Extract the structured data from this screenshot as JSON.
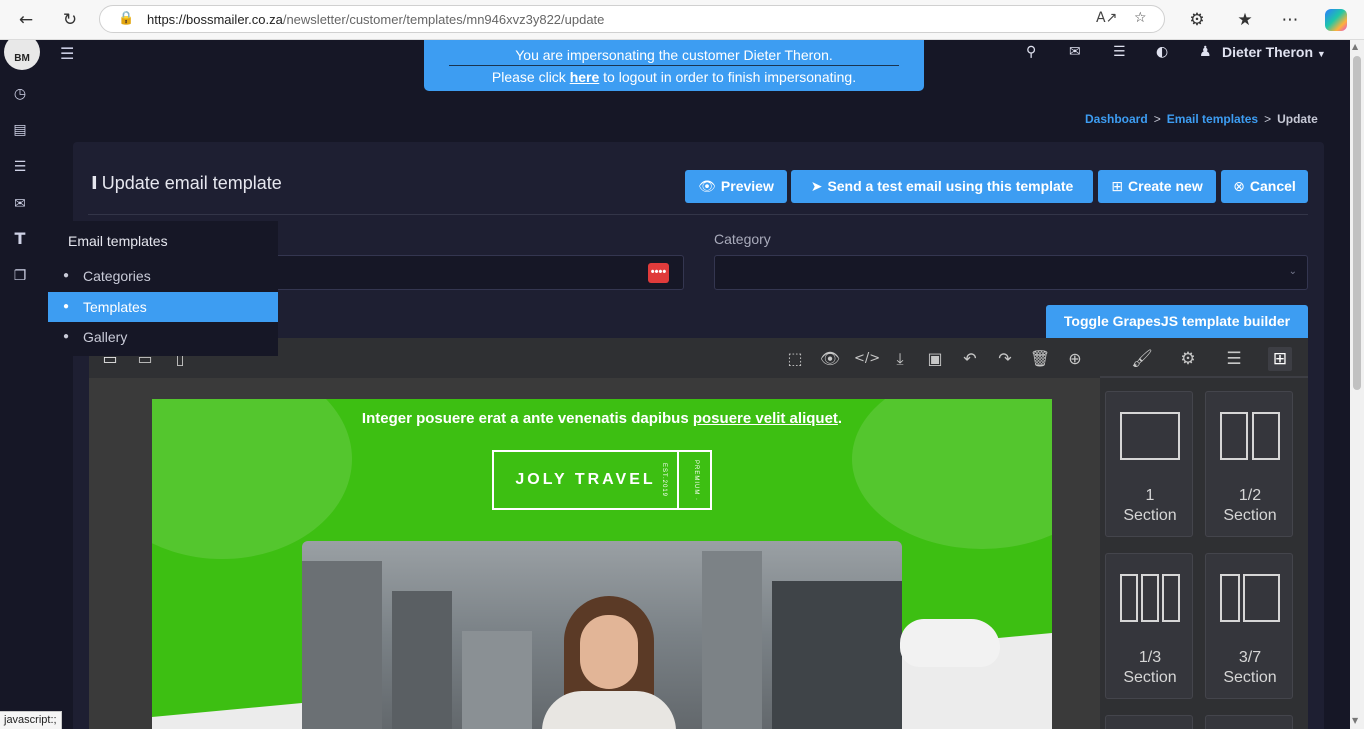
{
  "browser": {
    "url_host": "https://bossmailer.co.za",
    "url_path": "/newsletter/customer/templates/mn946xvz3y822/update",
    "status_text": "javascript:;"
  },
  "topbar": {
    "username": "Dieter Theron",
    "icons": [
      "search-icon",
      "envelope-icon",
      "list-icon",
      "contrast-icon",
      "user-icon"
    ]
  },
  "impersonation": {
    "line1": "You are impersonating the customer Dieter Theron.",
    "line2_before": "Please click ",
    "link": "here",
    "line2_after": " to logout in order to finish impersonating."
  },
  "breadcrumb": {
    "dashboard": "Dashboard",
    "email_templates": "Email templates",
    "current": "Update",
    "separator": ">"
  },
  "card": {
    "title": "Update email template",
    "buttons": {
      "preview": "Preview",
      "send_test": "Send a test email using this template",
      "create_new": "Create new",
      "cancel": "Cancel"
    },
    "category_label": "Category",
    "dots_label": "••••",
    "toggle_builder": "Toggle GrapesJS template builder"
  },
  "dropdown": {
    "heading": "Email templates",
    "items": [
      {
        "label": "Categories",
        "active": false
      },
      {
        "label": "Templates",
        "active": true
      },
      {
        "label": "Gallery",
        "active": false
      }
    ]
  },
  "editor": {
    "blocks": [
      {
        "num": "1",
        "label": "Section"
      },
      {
        "num": "1/2",
        "label": "Section"
      },
      {
        "num": "1/3",
        "label": "Section"
      },
      {
        "num": "3/7",
        "label": "Section"
      }
    ],
    "email": {
      "headline": "Integer posuere erat a ante venenatis dapibus ",
      "headline_link": "posuere velit aliquet",
      "headline_end": ".",
      "brand": "JOLY TRAVEL",
      "brand_tag": "PREMIUM · EST.2019"
    }
  },
  "colors": {
    "accent": "#3d9df2",
    "background": "#161726",
    "card": "#1e1f32",
    "email_green": "#3dbf12"
  }
}
